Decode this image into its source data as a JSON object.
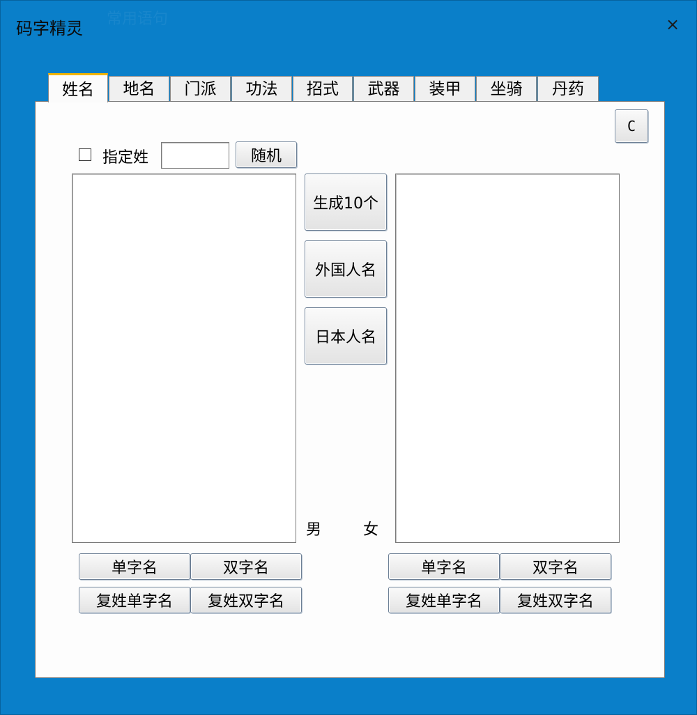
{
  "window": {
    "title": "码字精灵",
    "close_glyph": "×",
    "background_text": "常用语句"
  },
  "tabs": [
    {
      "label": "姓名",
      "active": true
    },
    {
      "label": "地名",
      "active": false
    },
    {
      "label": "门派",
      "active": false
    },
    {
      "label": "功法",
      "active": false
    },
    {
      "label": "招式",
      "active": false
    },
    {
      "label": "武器",
      "active": false
    },
    {
      "label": "装甲",
      "active": false
    },
    {
      "label": "坐骑",
      "active": false
    },
    {
      "label": "丹药",
      "active": false
    }
  ],
  "name_panel": {
    "c_button": "C",
    "specify_surname_label": "指定姓",
    "specify_surname_checked": false,
    "surname_input_value": "",
    "random_button": "随机",
    "generate_button": "生成10个",
    "foreign_button": "外国人名",
    "japanese_button": "日本人名",
    "male_label": "男",
    "female_label": "女",
    "male_list": [],
    "female_list": [],
    "male_buttons": {
      "single": "单字名",
      "double": "双字名",
      "compound_single": "复姓单字名",
      "compound_double": "复姓双字名"
    },
    "female_buttons": {
      "single": "单字名",
      "double": "双字名",
      "compound_single": "复姓单字名",
      "compound_double": "复姓双字名"
    }
  },
  "colors": {
    "window_frame": "#0a7fc9",
    "active_tab_accent": "#f2b400",
    "panel_background": "#fdfdfd"
  }
}
